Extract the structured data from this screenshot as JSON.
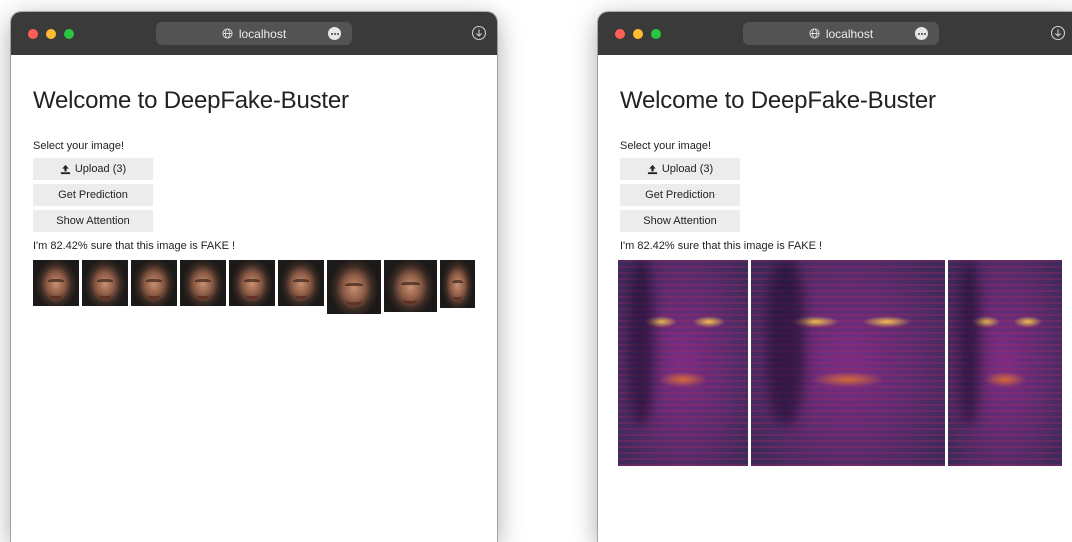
{
  "windows": [
    {
      "url": "localhost",
      "heading": "Welcome to DeepFake-Buster",
      "select_label": "Select your image!",
      "buttons": {
        "upload": "Upload (3)",
        "predict": "Get Prediction",
        "attention": "Show Attention"
      },
      "result": "I'm 82.42% sure that this image is FAKE !",
      "thumbnail_count": 9
    },
    {
      "url": "localhost",
      "heading": "Welcome to DeepFake-Buster",
      "select_label": "Select your image!",
      "buttons": {
        "upload": "Upload (3)",
        "predict": "Get Prediction",
        "attention": "Show Attention"
      },
      "result": "I'm 82.42% sure that this image is FAKE !",
      "attention_map_count": 3
    }
  ],
  "colors": {
    "titlebar": "#3a3a3a",
    "button_bg": "#ececec",
    "traffic_red": "#ff5f57",
    "traffic_yellow": "#febc2e",
    "traffic_green": "#28c840"
  },
  "icons": [
    "globe-icon",
    "more-icon",
    "download-icon",
    "upload-icon"
  ]
}
